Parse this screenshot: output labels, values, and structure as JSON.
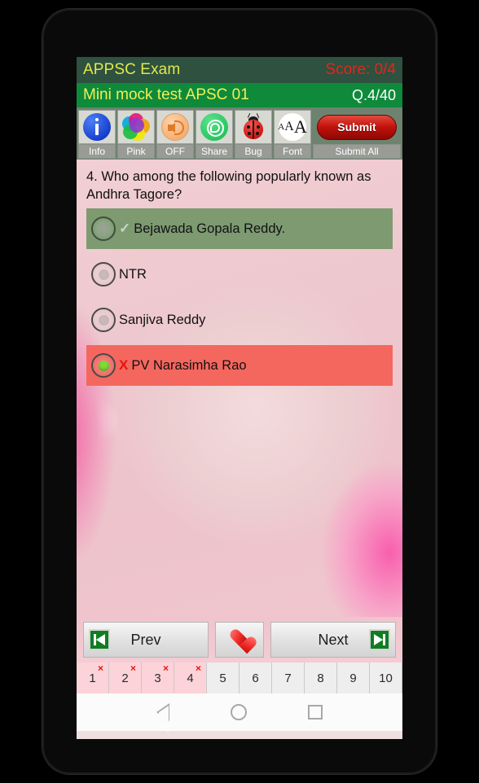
{
  "header": {
    "app_title": "APPSC Exam",
    "score_label": "Score: 0/4",
    "test_title": "Mini mock test APSC 01",
    "question_counter": "Q.4/40",
    "colors": {
      "title_bar_bg": "#2e5140",
      "test_bar_bg": "#0e8a3a",
      "app_title_color": "#e2e84a",
      "score_color": "#e8231a",
      "counter_color": "#ffffff"
    }
  },
  "toolbar": {
    "items": [
      {
        "label": "Info",
        "icon": "info-icon"
      },
      {
        "label": "Pink",
        "icon": "color-palette-icon"
      },
      {
        "label": "OFF",
        "icon": "speaker-icon"
      },
      {
        "label": "Share",
        "icon": "whatsapp-share-icon"
      },
      {
        "label": "Bug",
        "icon": "ladybug-icon"
      },
      {
        "label": "Font",
        "icon": "font-size-icon"
      },
      {
        "label": "Submit All",
        "icon": "submit-pill-icon"
      }
    ],
    "submit_label": "Submit"
  },
  "question": {
    "text": "4. Who among the following popularly known as Andhra Tagore?",
    "options": [
      {
        "label": "Bejawada Gopala Reddy.",
        "state": "correct",
        "mark": "✓",
        "selected": false
      },
      {
        "label": "NTR",
        "state": "plain",
        "mark": "",
        "selected": false
      },
      {
        "label": "Sanjiva Reddy",
        "state": "plain",
        "mark": "",
        "selected": false
      },
      {
        "label": "PV Narasimha Rao",
        "state": "wrong",
        "mark": "X",
        "selected": true
      }
    ],
    "colors": {
      "correct_bg": "#7d9a71",
      "wrong_bg": "#f4675f",
      "selected_dot": "#7ddc34",
      "cross_color": "#e8130f"
    }
  },
  "nav": {
    "prev_label": "Prev",
    "next_label": "Next",
    "favorite_icon": "heart-icon",
    "prev_icon": "skip-to-start-icon",
    "next_icon": "skip-to-end-icon"
  },
  "question_numbers": [
    {
      "n": "1",
      "attempted": true,
      "mark": "×"
    },
    {
      "n": "2",
      "attempted": true,
      "mark": "×"
    },
    {
      "n": "3",
      "attempted": true,
      "mark": "×"
    },
    {
      "n": "4",
      "attempted": true,
      "mark": "×"
    },
    {
      "n": "5",
      "attempted": false,
      "mark": ""
    },
    {
      "n": "6",
      "attempted": false,
      "mark": ""
    },
    {
      "n": "7",
      "attempted": false,
      "mark": ""
    },
    {
      "n": "8",
      "attempted": false,
      "mark": ""
    },
    {
      "n": "9",
      "attempted": false,
      "mark": ""
    },
    {
      "n": "10",
      "attempted": false,
      "mark": ""
    }
  ],
  "android_nav": {
    "back": "back-triangle-icon",
    "home": "home-circle-icon",
    "recents": "recents-square-icon"
  }
}
